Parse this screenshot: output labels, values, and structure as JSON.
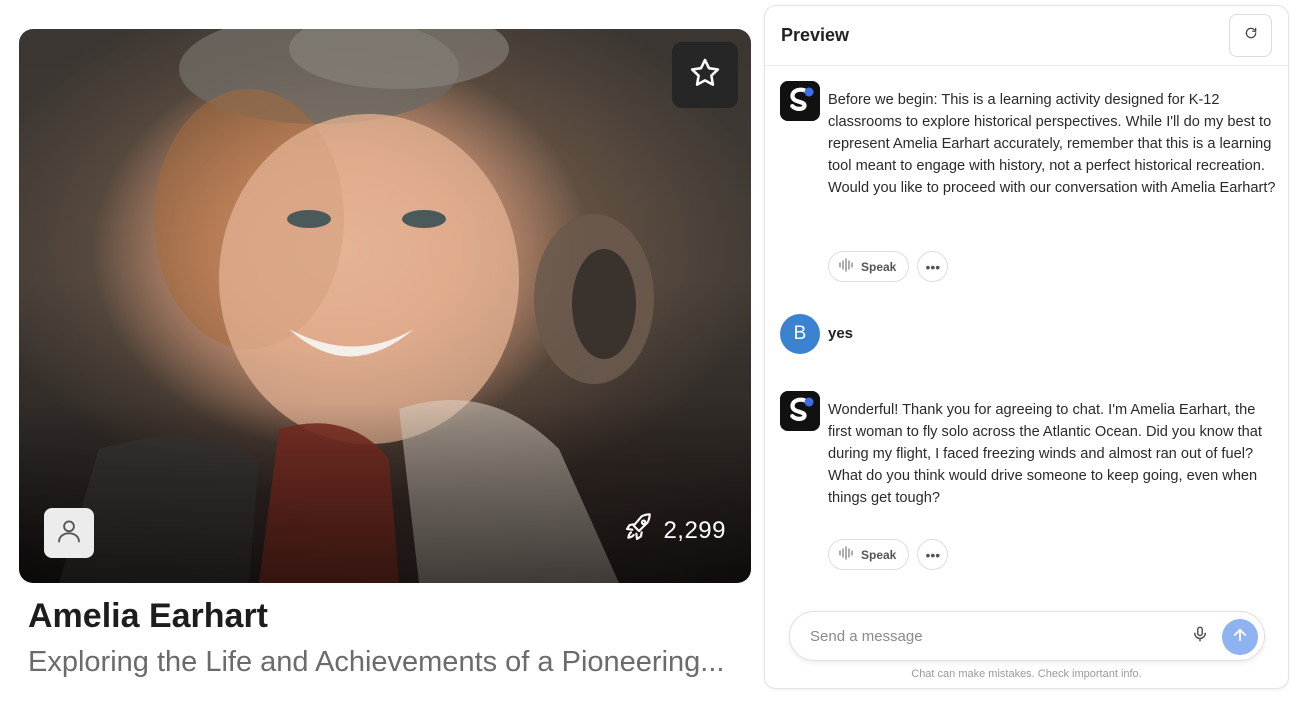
{
  "character": {
    "name": "Amelia Earhart",
    "description": "Exploring the Life and Achievements of a Pioneering...",
    "uses_count": "2,299",
    "icons": {
      "favorite": "star-icon",
      "creator": "user-icon",
      "uses": "rocket-icon"
    }
  },
  "preview": {
    "title": "Preview",
    "refresh_icon": "refresh-icon",
    "messages": [
      {
        "role": "bot",
        "text": "Before we begin: This is a learning activity designed for K-12 classrooms to explore historical perspectives. While I'll do my best to represent Amelia Earhart accurately, remember that this is a learning tool meant to engage with history, not a perfect historical recreation. Would you like to proceed with our conversation with Amelia Earhart?",
        "speak_label": "Speak"
      },
      {
        "role": "user",
        "avatar_letter": "B",
        "text": "yes"
      },
      {
        "role": "bot",
        "text": "Wonderful! Thank you for agreeing to chat. I'm Amelia Earhart, the first woman to fly solo across the Atlantic Ocean. Did you know that during my flight, I faced freezing winds and almost ran out of fuel? What do you think would drive someone to keep going, even when things get tough?",
        "speak_label": "Speak"
      }
    ],
    "composer": {
      "placeholder": "Send a message",
      "disclaimer": "Chat can make mistakes. Check important info."
    }
  },
  "colors": {
    "user_avatar": "#3b82d0",
    "send_button": "#8fb2f0",
    "bot_avatar": "#111111"
  }
}
